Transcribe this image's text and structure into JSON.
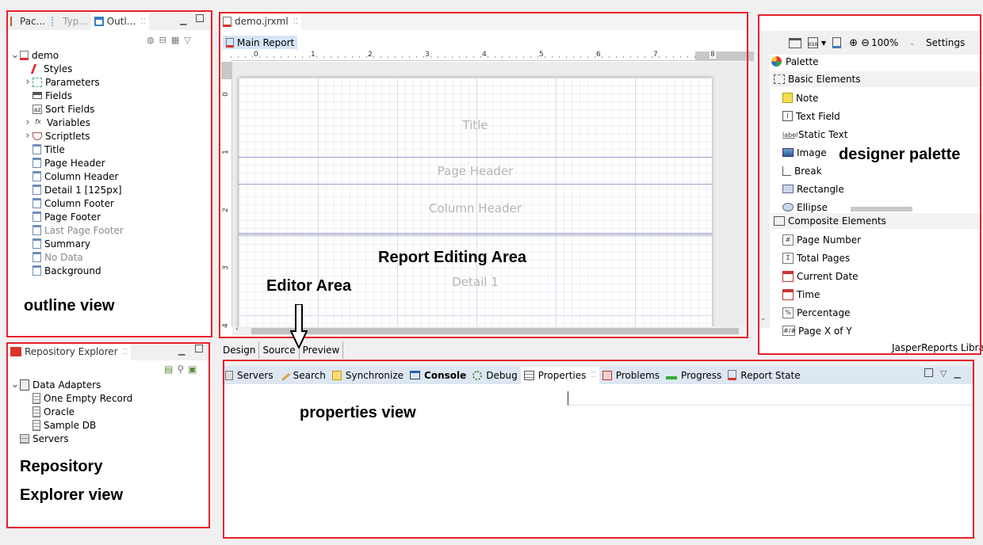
{
  "outline": {
    "tabs": [
      "Pac...",
      "Typ...",
      "Outl..."
    ],
    "tree": [
      {
        "label": "demo",
        "twisty": "v",
        "indent": 0,
        "icon": "report-icon"
      },
      {
        "label": "Styles",
        "twisty": "",
        "indent": 1,
        "icon": "styles-icon"
      },
      {
        "label": "Parameters",
        "twisty": ">",
        "indent": 1,
        "icon": "parameters-icon"
      },
      {
        "label": "Fields",
        "twisty": "",
        "indent": 1,
        "icon": "fields-icon"
      },
      {
        "label": "Sort Fields",
        "twisty": "",
        "indent": 1,
        "icon": "sort-fields-icon"
      },
      {
        "label": "Variables",
        "twisty": ">",
        "indent": 1,
        "icon": "variables-icon"
      },
      {
        "label": "Scriptlets",
        "twisty": ">",
        "indent": 1,
        "icon": "scriptlets-icon"
      },
      {
        "label": "Title",
        "twisty": "",
        "indent": 1,
        "icon": "band-icon"
      },
      {
        "label": "Page Header",
        "twisty": "",
        "indent": 1,
        "icon": "band-icon"
      },
      {
        "label": "Column Header",
        "twisty": "",
        "indent": 1,
        "icon": "band-icon"
      },
      {
        "label": "Detail 1 [125px]",
        "twisty": "",
        "indent": 1,
        "icon": "band-icon"
      },
      {
        "label": "Column Footer",
        "twisty": "",
        "indent": 1,
        "icon": "band-icon"
      },
      {
        "label": "Page Footer",
        "twisty": "",
        "indent": 1,
        "icon": "band-icon"
      },
      {
        "label": "Last Page Footer",
        "twisty": "",
        "indent": 1,
        "icon": "band-icon",
        "muted": true
      },
      {
        "label": "Summary",
        "twisty": "",
        "indent": 1,
        "icon": "band-icon"
      },
      {
        "label": "No Data",
        "twisty": "",
        "indent": 1,
        "icon": "band-icon",
        "muted": true
      },
      {
        "label": "Background",
        "twisty": "",
        "indent": 1,
        "icon": "band-icon"
      }
    ]
  },
  "repository": {
    "tab": "Repository Explorer",
    "tree": [
      {
        "label": "Data Adapters",
        "twisty": "v",
        "indent": 0,
        "icon": "folder-icon"
      },
      {
        "label": "One Empty Record",
        "twisty": "",
        "indent": 1,
        "icon": "database-icon"
      },
      {
        "label": "Oracle",
        "twisty": "",
        "indent": 1,
        "icon": "database-icon"
      },
      {
        "label": "Sample DB",
        "twisty": "",
        "indent": 1,
        "icon": "database-icon"
      },
      {
        "label": "Servers",
        "twisty": "",
        "indent": 0,
        "icon": "server-icon"
      }
    ]
  },
  "editor": {
    "tab": "demo.jrxml",
    "breadcrumb": "Main Report",
    "ruler_h": [
      "0",
      "1",
      "2",
      "3",
      "4",
      "5",
      "6",
      "7",
      "8"
    ],
    "ruler_v": [
      "0",
      "1",
      "2",
      "3",
      "4"
    ],
    "bands": [
      "Title",
      "Page Header",
      "Column Header",
      "Detail 1"
    ],
    "bottom_tabs": [
      "Design",
      "Source",
      "Preview"
    ]
  },
  "palette": {
    "zoom": "100%",
    "settings": "Settings",
    "title": "Palette",
    "basic_group": "Basic Elements",
    "basic_items": [
      {
        "label": "Note",
        "icon": "note-icon"
      },
      {
        "label": "Text Field",
        "icon": "text-field-icon"
      },
      {
        "label": "Static Text",
        "icon": "static-text-icon"
      },
      {
        "label": "Image",
        "icon": "image-icon"
      },
      {
        "label": "Break",
        "icon": "break-icon"
      },
      {
        "label": "Rectangle",
        "icon": "rectangle-icon"
      },
      {
        "label": "Ellipse",
        "icon": "ellipse-icon"
      }
    ],
    "composite_group": "Composite Elements",
    "composite_items": [
      {
        "label": "Page Number",
        "icon": "hash-icon"
      },
      {
        "label": "Total Pages",
        "icon": "sigma-icon"
      },
      {
        "label": "Current Date",
        "icon": "calendar-icon"
      },
      {
        "label": "Time",
        "icon": "calendar-icon"
      },
      {
        "label": "Percentage",
        "icon": "percent-icon"
      },
      {
        "label": "Page X of Y",
        "icon": "page-x-of-y-icon"
      }
    ],
    "footer": "JasperReports Librar"
  },
  "bottom": {
    "tabs": [
      {
        "label": "Servers",
        "icon": "servers-icon"
      },
      {
        "label": "Search",
        "icon": "search-icon"
      },
      {
        "label": "Synchronize",
        "icon": "synchronize-icon"
      },
      {
        "label": "Console",
        "icon": "console-icon",
        "bold": true
      },
      {
        "label": "Debug",
        "icon": "debug-icon"
      },
      {
        "label": "Properties",
        "icon": "properties-icon",
        "active": true
      },
      {
        "label": "Problems",
        "icon": "problems-icon"
      },
      {
        "label": "Progress",
        "icon": "progress-icon"
      },
      {
        "label": "Report State",
        "icon": "report-state-icon"
      }
    ]
  },
  "annotations": {
    "outline": "outline view",
    "editor": "Editor Area",
    "report": "Report Editing Area",
    "palette": "designer palette",
    "properties": "properties view",
    "repo1": "Repository",
    "repo2": "Explorer view"
  },
  "colors": {
    "annotation_border": "#e8202a",
    "tab_active": "#ffffff",
    "selection": "#d5e5f7"
  }
}
